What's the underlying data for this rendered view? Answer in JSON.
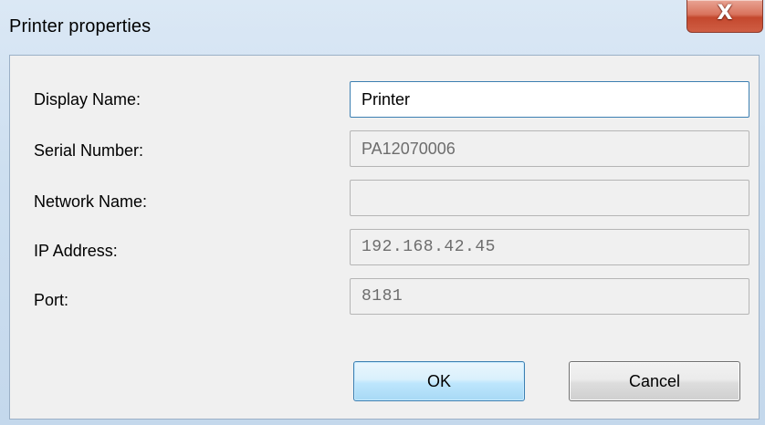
{
  "window": {
    "title": "Printer properties",
    "close_glyph": "X"
  },
  "form": {
    "display_name": {
      "label": "Display Name:",
      "value": "Printer"
    },
    "serial_number": {
      "label": "Serial Number:",
      "value": "PA12070006"
    },
    "network_name": {
      "label": "Network Name:",
      "value": ""
    },
    "ip_address": {
      "label": "IP Address:",
      "value": "192.168.42.45"
    },
    "port": {
      "label": "Port:",
      "value": "8181"
    }
  },
  "buttons": {
    "ok": "OK",
    "cancel": "Cancel"
  },
  "colors": {
    "accent_border": "#3c7fb1",
    "close_red": "#c4482e",
    "dialog_bg": "#f0f0f0"
  }
}
